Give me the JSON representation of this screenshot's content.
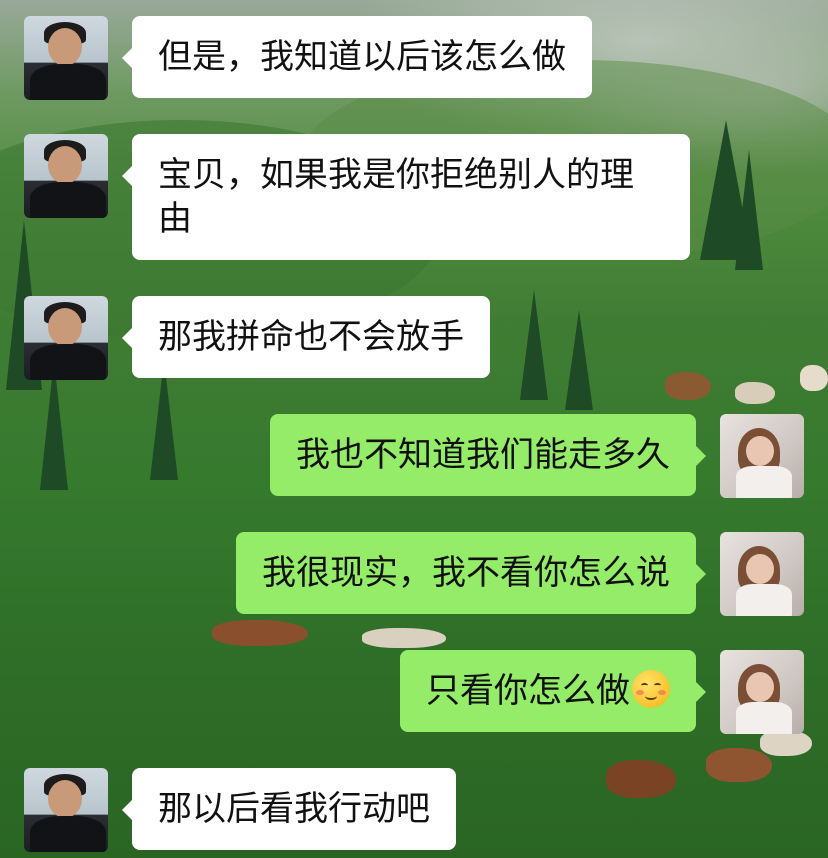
{
  "colors": {
    "incoming_bubble": "#ffffff",
    "outgoing_bubble": "#95ec69",
    "text": "#111111"
  },
  "messages": [
    {
      "side": "left",
      "avatar": "boy-avatar",
      "text": "但是，我知道以后该怎么做"
    },
    {
      "side": "left",
      "avatar": "boy-avatar",
      "text": "宝贝，如果我是你拒绝别人的理由"
    },
    {
      "side": "left",
      "avatar": "boy-avatar",
      "text": "那我拼命也不会放手"
    },
    {
      "side": "right",
      "avatar": "girl-avatar",
      "text": "我也不知道我们能走多久"
    },
    {
      "side": "right",
      "avatar": "girl-avatar",
      "text": "我很现实，我不看你怎么说"
    },
    {
      "side": "right",
      "avatar": "girl-avatar",
      "text": "只看你怎么做",
      "emoji": "smiling-face-emoji"
    },
    {
      "side": "left",
      "avatar": "boy-avatar",
      "text": "那以后看我行动吧"
    }
  ]
}
